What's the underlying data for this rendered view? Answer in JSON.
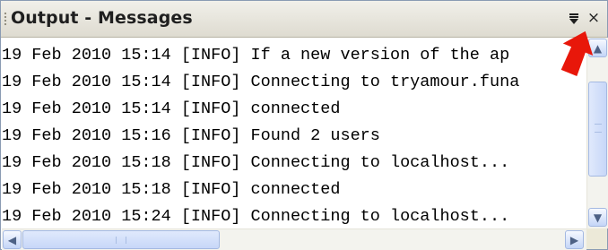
{
  "panel": {
    "title": "Output - Messages",
    "dropdown_icon": "dropdown-menu-icon",
    "close_icon": "close-icon",
    "close_glyph": "×",
    "dropdown_glyph": "▼"
  },
  "log": {
    "partial_line": "                           .      .      .",
    "lines": [
      "19 Feb 2010 15:14 [INFO] If a new version of the ap",
      "19 Feb 2010 15:14 [INFO] Connecting to tryamour.funa",
      "19 Feb 2010 15:14 [INFO] connected",
      "19 Feb 2010 15:16 [INFO] Found 2 users",
      "19 Feb 2010 15:18 [INFO] Connecting to localhost...",
      "19 Feb 2010 15:18 [INFO] connected",
      "19 Feb 2010 15:24 [INFO] Connecting to localhost..."
    ]
  },
  "scrollbars": {
    "up_glyph": "▲",
    "down_glyph": "▼",
    "left_glyph": "◀",
    "right_glyph": "▶"
  },
  "annotation": {
    "arrow_color": "#e8170a"
  }
}
